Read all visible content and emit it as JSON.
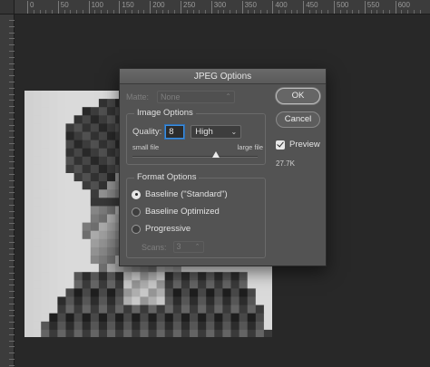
{
  "ruler": {
    "labels": [
      "0",
      "50",
      "100",
      "150",
      "200",
      "250",
      "300",
      "350",
      "400",
      "450",
      "500",
      "550",
      "600"
    ]
  },
  "canvas": {
    "image_description_icon": "portrait-image"
  },
  "dialog": {
    "title": "JPEG Options",
    "matte": {
      "label": "Matte:",
      "value": "None"
    },
    "image_options": {
      "title": "Image Options",
      "quality_label": "Quality:",
      "quality_value": "8",
      "quality_preset": "High",
      "small_file_label": "small file",
      "large_file_label": "large file",
      "slider_level": 0.67
    },
    "format_options": {
      "title": "Format Options",
      "options": [
        {
          "label": "Baseline (\"Standard\")",
          "selected": true
        },
        {
          "label": "Baseline Optimized",
          "selected": false
        },
        {
          "label": "Progressive",
          "selected": false
        }
      ],
      "scans_label": "Scans:",
      "scans_value": "3"
    },
    "buttons": {
      "ok": "OK",
      "cancel": "Cancel"
    },
    "preview": {
      "label": "Preview",
      "checked": true
    },
    "file_size": "27.7K"
  },
  "colors": {
    "dialog_bg": "#535353",
    "focus_ring": "#3d8fe0",
    "workspace_bg": "#282828"
  }
}
